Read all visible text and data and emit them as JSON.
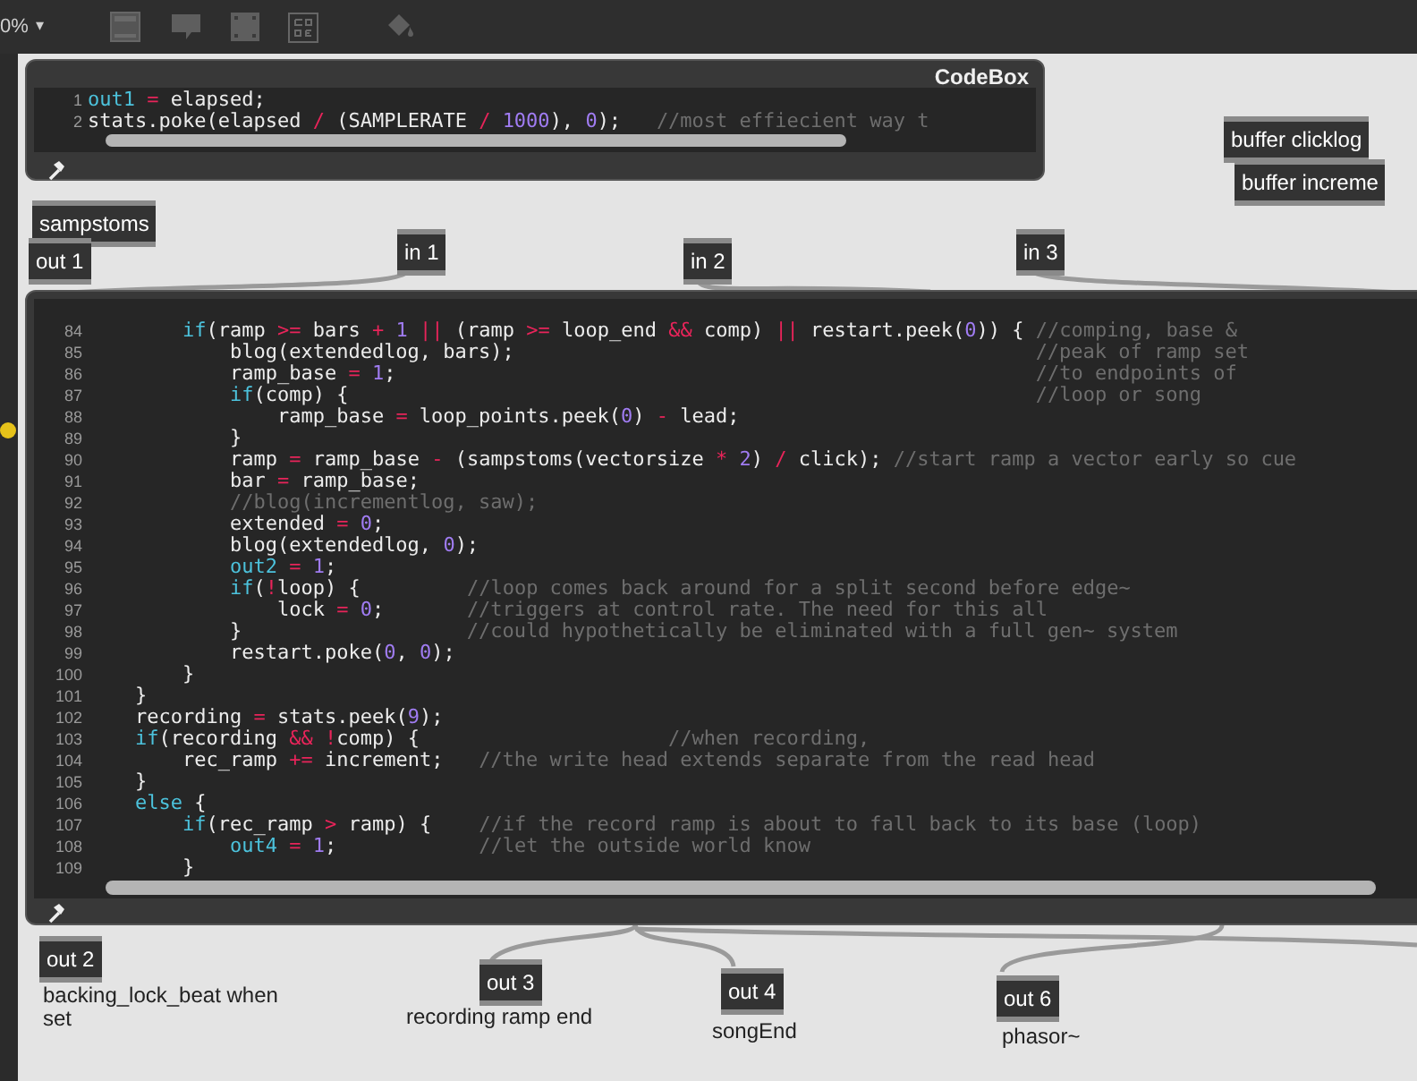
{
  "toolbar": {
    "zoom": "0%",
    "zoom_caret": "▾"
  },
  "objects": [
    {
      "text": "buffer clicklog"
    },
    {
      "text": "buffer increme"
    },
    {
      "text": "sampstoms"
    },
    {
      "text": "out 1"
    },
    {
      "text": "in 1"
    },
    {
      "text": "in 2"
    },
    {
      "text": "in 3"
    },
    {
      "text": "out 2"
    },
    {
      "text": "out 3"
    },
    {
      "text": "out 4"
    },
    {
      "text": "out 6"
    }
  ],
  "comments": [
    {
      "text": "backing_lock_beat when set"
    },
    {
      "text": "recording ramp end"
    },
    {
      "text": "songEnd"
    },
    {
      "text": "phasor~"
    }
  ],
  "codeboxes": [
    {
      "title": "CodeBox",
      "lines": [
        {
          "number": "1",
          "code": "out1 = elapsed;"
        },
        {
          "number": "2",
          "code": "stats.poke(elapsed / (SAMPLERATE / 1000), 0);   ",
          "comment": "//most effiecient way t"
        }
      ]
    },
    {
      "lines": [
        {
          "number": "84",
          "code": "        if(ramp >= bars + 1 || (ramp >= loop_end && comp) || restart.peek(0)) { ",
          "comment": "//comping, base &"
        },
        {
          "number": "85",
          "code": "            blog(extendedlog, bars);                                            ",
          "comment": "//peak of ramp set"
        },
        {
          "number": "86",
          "code": "            ramp_base = 1;                                                      ",
          "comment": "//to endpoints of"
        },
        {
          "number": "87",
          "code": "            if(comp) {                                                          ",
          "comment": "//loop or song"
        },
        {
          "number": "88",
          "code": "                ramp_base = loop_points.peek(0) - lead;"
        },
        {
          "number": "89",
          "code": "            }"
        },
        {
          "number": "90",
          "code": "            ramp = ramp_base - (sampstoms(vectorsize * 2) / click); ",
          "comment": "//start ramp a vector early so cue"
        },
        {
          "number": "91",
          "code": "            bar = ramp_base;"
        },
        {
          "number": "92",
          "comment": "            //blog(incrementlog, saw);"
        },
        {
          "number": "93",
          "code": "            extended = 0;"
        },
        {
          "number": "94",
          "code": "            blog(extendedlog, 0);"
        },
        {
          "number": "95",
          "code": "            out2 = 1;"
        },
        {
          "number": "96",
          "code": "            if(!loop) {         ",
          "comment": "//loop comes back around for a split second before edge~"
        },
        {
          "number": "97",
          "code": "                lock = 0;       ",
          "comment": "//triggers at control rate. The need for this all"
        },
        {
          "number": "98",
          "code": "            }                   ",
          "comment": "//could hypothetically be eliminated with a full gen~ system"
        },
        {
          "number": "99",
          "code": "            restart.poke(0, 0);"
        },
        {
          "number": "100",
          "code": "        }"
        },
        {
          "number": "101",
          "code": "    }"
        },
        {
          "number": "102",
          "code": "    recording = stats.peek(9);"
        },
        {
          "number": "103",
          "code": "    if(recording && !comp) {                     ",
          "comment": "//when recording,"
        },
        {
          "number": "104",
          "code": "        rec_ramp += increment;   ",
          "comment": "//the write head extends separate from the read head"
        },
        {
          "number": "105",
          "code": "    }"
        },
        {
          "number": "106",
          "code": "    else {"
        },
        {
          "number": "107",
          "code": "        if(rec_ramp > ramp) {    ",
          "comment": "//if the record ramp is about to fall back to its base (loop)"
        },
        {
          "number": "108",
          "code": "            out4 = 1;            ",
          "comment": "//let the outside world know"
        },
        {
          "number": "109",
          "code": "        }"
        }
      ]
    }
  ]
}
